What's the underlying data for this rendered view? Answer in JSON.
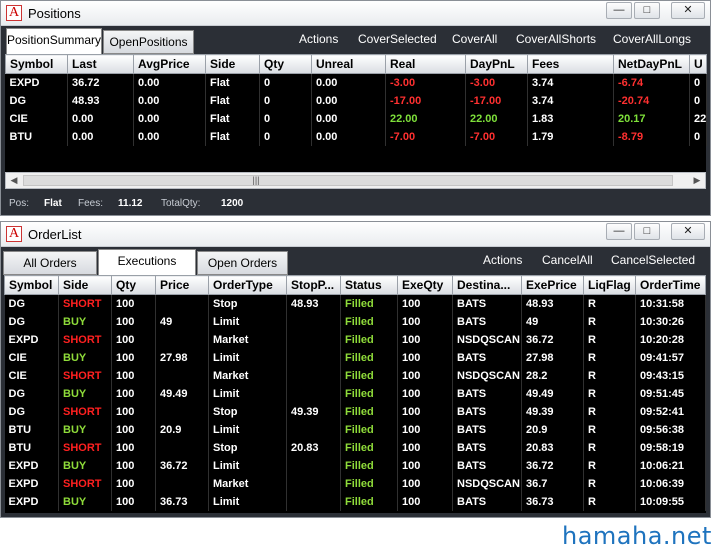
{
  "positions_window": {
    "title": "Positions",
    "controls": {
      "minimize": "—",
      "maximize": "□",
      "close": "✕"
    },
    "tabs": [
      "PositionSummary",
      "OpenPositions"
    ],
    "active_tab": 0,
    "actions": [
      "Actions",
      "CoverSelected",
      "CoverAll",
      "CoverAllShorts",
      "CoverAllLongs"
    ],
    "columns": [
      "Symbol",
      "Last",
      "AvgPrice",
      "Side",
      "Qty",
      "Unreal",
      "Real",
      "DayPnL",
      "Fees",
      "NetDayPnL",
      "U"
    ],
    "rows": [
      {
        "symbol": "EXPD",
        "last": "36.72",
        "avg": "0.00",
        "side": "Flat",
        "qty": "0",
        "unreal": "0.00",
        "real": "-3.00",
        "daypnl": "-3.00",
        "fees": "3.74",
        "net": "-6.74",
        "u": "0"
      },
      {
        "symbol": "DG",
        "last": "48.93",
        "avg": "0.00",
        "side": "Flat",
        "qty": "0",
        "unreal": "0.00",
        "real": "-17.00",
        "daypnl": "-17.00",
        "fees": "3.74",
        "net": "-20.74",
        "u": "0"
      },
      {
        "symbol": "CIE",
        "last": "0.00",
        "avg": "0.00",
        "side": "Flat",
        "qty": "0",
        "unreal": "0.00",
        "real": "22.00",
        "daypnl": "22.00",
        "fees": "1.83",
        "net": "20.17",
        "u": "22"
      },
      {
        "symbol": "BTU",
        "last": "0.00",
        "avg": "0.00",
        "side": "Flat",
        "qty": "0",
        "unreal": "0.00",
        "real": "-7.00",
        "daypnl": "-7.00",
        "fees": "1.79",
        "net": "-8.79",
        "u": "0"
      }
    ],
    "status": {
      "pos_label": "Pos:",
      "pos_value": "Flat",
      "fees_label": "Fees:",
      "fees_value": "11.12",
      "qty_label": "TotalQty:",
      "qty_value": "1200"
    },
    "scroll_left": "◀",
    "scroll_right": "▶",
    "scroll_grip": "|||"
  },
  "orderlist_window": {
    "title": "OrderList",
    "controls": {
      "minimize": "—",
      "maximize": "□",
      "close": "✕"
    },
    "tabs": [
      "All Orders",
      "Executions",
      "Open Orders"
    ],
    "active_tab": 1,
    "actions": [
      "Actions",
      "CancelAll",
      "CancelSelected"
    ],
    "columns": [
      "Symbol",
      "Side",
      "Qty",
      "Price",
      "OrderType",
      "StopP...",
      "Status",
      "ExeQty",
      "Destina...",
      "ExePrice",
      "LiqFlag",
      "OrderTime"
    ],
    "rows": [
      {
        "symbol": "DG",
        "side": "SHORT",
        "qty": "100",
        "price": "",
        "type": "Stop",
        "stop": "48.93",
        "status": "Filled",
        "exeqty": "100",
        "dest": "BATS",
        "exeprice": "48.93",
        "liq": "R",
        "time": "10:31:58"
      },
      {
        "symbol": "DG",
        "side": "BUY",
        "qty": "100",
        "price": "49",
        "type": "Limit",
        "stop": "",
        "status": "Filled",
        "exeqty": "100",
        "dest": "BATS",
        "exeprice": "49",
        "liq": "R",
        "time": "10:30:26"
      },
      {
        "symbol": "EXPD",
        "side": "SHORT",
        "qty": "100",
        "price": "",
        "type": "Market",
        "stop": "",
        "status": "Filled",
        "exeqty": "100",
        "dest": "NSDQSCAN",
        "exeprice": "36.72",
        "liq": "R",
        "time": "10:20:28"
      },
      {
        "symbol": "CIE",
        "side": "BUY",
        "qty": "100",
        "price": "27.98",
        "type": "Limit",
        "stop": "",
        "status": "Filled",
        "exeqty": "100",
        "dest": "BATS",
        "exeprice": "27.98",
        "liq": "R",
        "time": "09:41:57"
      },
      {
        "symbol": "CIE",
        "side": "SHORT",
        "qty": "100",
        "price": "",
        "type": "Market",
        "stop": "",
        "status": "Filled",
        "exeqty": "100",
        "dest": "NSDQSCAN",
        "exeprice": "28.2",
        "liq": "R",
        "time": "09:43:15"
      },
      {
        "symbol": "DG",
        "side": "BUY",
        "qty": "100",
        "price": "49.49",
        "type": "Limit",
        "stop": "",
        "status": "Filled",
        "exeqty": "100",
        "dest": "BATS",
        "exeprice": "49.49",
        "liq": "R",
        "time": "09:51:45"
      },
      {
        "symbol": "DG",
        "side": "SHORT",
        "qty": "100",
        "price": "",
        "type": "Stop",
        "stop": "49.39",
        "status": "Filled",
        "exeqty": "100",
        "dest": "BATS",
        "exeprice": "49.39",
        "liq": "R",
        "time": "09:52:41"
      },
      {
        "symbol": "BTU",
        "side": "BUY",
        "qty": "100",
        "price": "20.9",
        "type": "Limit",
        "stop": "",
        "status": "Filled",
        "exeqty": "100",
        "dest": "BATS",
        "exeprice": "20.9",
        "liq": "R",
        "time": "09:56:38"
      },
      {
        "symbol": "BTU",
        "side": "SHORT",
        "qty": "100",
        "price": "",
        "type": "Stop",
        "stop": "20.83",
        "status": "Filled",
        "exeqty": "100",
        "dest": "BATS",
        "exeprice": "20.83",
        "liq": "R",
        "time": "09:58:19"
      },
      {
        "symbol": "EXPD",
        "side": "BUY",
        "qty": "100",
        "price": "36.72",
        "type": "Limit",
        "stop": "",
        "status": "Filled",
        "exeqty": "100",
        "dest": "BATS",
        "exeprice": "36.72",
        "liq": "R",
        "time": "10:06:21"
      },
      {
        "symbol": "EXPD",
        "side": "SHORT",
        "qty": "100",
        "price": "",
        "type": "Market",
        "stop": "",
        "status": "Filled",
        "exeqty": "100",
        "dest": "NSDQSCAN",
        "exeprice": "36.7",
        "liq": "R",
        "time": "10:06:39"
      },
      {
        "symbol": "EXPD",
        "side": "BUY",
        "qty": "100",
        "price": "36.73",
        "type": "Limit",
        "stop": "",
        "status": "Filled",
        "exeqty": "100",
        "dest": "BATS",
        "exeprice": "36.73",
        "liq": "R",
        "time": "10:09:55"
      }
    ]
  },
  "watermark": "hamaha.net",
  "colors": {
    "negative": "#ff3030",
    "positive": "#7ee03a",
    "short": "#ff2020",
    "buy": "#8fdc3a",
    "panel": "#2b2f36",
    "grid": "#000000"
  }
}
